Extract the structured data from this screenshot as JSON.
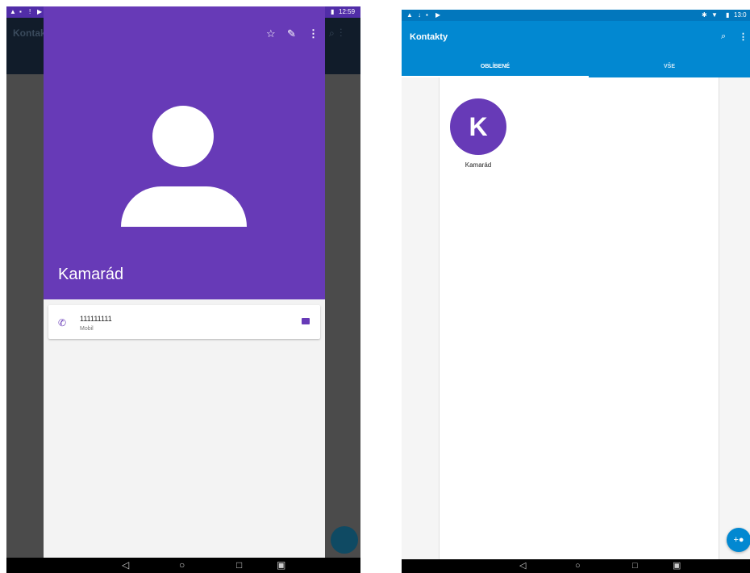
{
  "left": {
    "status": {
      "time": "12:59"
    },
    "background": {
      "title": "Kontakty"
    },
    "contact": {
      "name": "Kamarád",
      "phone": "111111111",
      "phone_type": "Mobil"
    },
    "header_icons": {
      "star": "☆",
      "edit": "✎",
      "more": "⋮"
    },
    "nav": {
      "back": "◁",
      "home": "○",
      "recents": "□",
      "extra": "▣"
    },
    "colors": {
      "header": "#673ab7"
    }
  },
  "right": {
    "status": {
      "time": "13:0"
    },
    "app_title": "Kontakty",
    "tabs": [
      {
        "label": "OBLÍBENÉ",
        "selected": true
      },
      {
        "label": "VŠE",
        "selected": false
      }
    ],
    "favorite": {
      "initial": "K",
      "name": "Kamarád"
    },
    "nav": {
      "back": "◁",
      "home": "○",
      "recents": "□",
      "extra": "▣"
    },
    "colors": {
      "appbar": "#0288d1",
      "avatar": "#673ab7"
    }
  }
}
